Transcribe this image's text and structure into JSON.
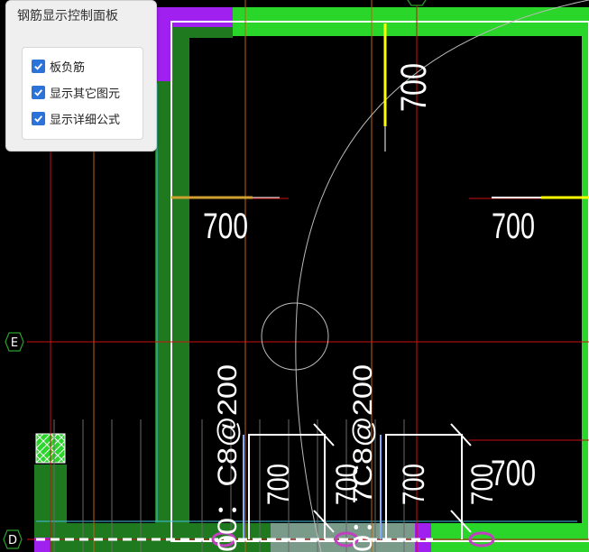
{
  "panel": {
    "title": "钢筋显示控制面板",
    "options": [
      {
        "label": "板负筋",
        "checked": true
      },
      {
        "label": "显示其它图元",
        "checked": true
      },
      {
        "label": "显示详细公式",
        "checked": true
      }
    ]
  },
  "drawing": {
    "axis_labels": {
      "e": "E",
      "d": "D"
    },
    "dimensions": {
      "top_vertical": "700",
      "left_horizontal": "700",
      "right_horizontal": "700",
      "bottom_right": "700",
      "rebar_left_vertical": "700",
      "rebar_mid_vertical": "700",
      "rebar_right_vertical": "700",
      "rebar_far_vertical": "700",
      "rebar_spec_1": "00：C8@200",
      "rebar_spec_2": "0：7C8@200"
    },
    "colors": {
      "background": "#000000",
      "slab_fill": "#2ad62a",
      "slab_dark": "#1f7a1f",
      "column": "#a020f0",
      "axis_line": "#cc1111",
      "grid_line": "#c06010",
      "rebar": "#ffffff",
      "highlight": "#ffff00"
    }
  }
}
